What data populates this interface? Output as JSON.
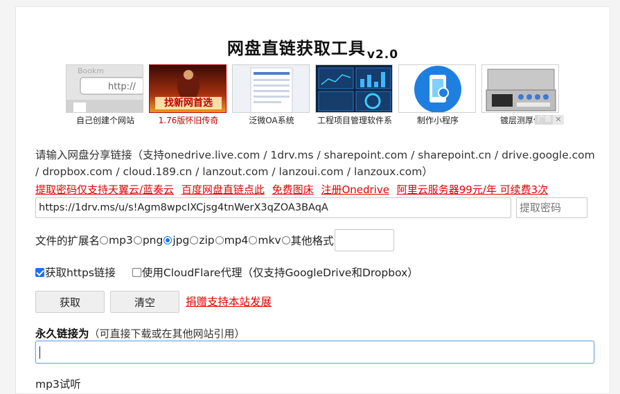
{
  "title": {
    "main": "网盘直链获取工具",
    "version": "v2.0"
  },
  "ads": [
    {
      "caption": "自己创建个网站",
      "icon": "browser-url-bar-image",
      "red": false
    },
    {
      "caption": "1.76版怀旧传奇",
      "icon": "game-warrior-image",
      "red": true,
      "overlay": "找新网首选"
    },
    {
      "caption": "泛微OA系统",
      "icon": "document-form-image",
      "red": false
    },
    {
      "caption": "工程项目管理软件系",
      "icon": "dashboard-screens-image",
      "red": false
    },
    {
      "caption": "制作小程序",
      "icon": "phone-app-image",
      "red": false
    },
    {
      "caption": "镀层测厚仪",
      "icon": "instrument-case-image",
      "red": false
    }
  ],
  "ad_badge": "广告",
  "description": "请输入网盘分享链接（支持onedrive.live.com / 1drv.ms / sharepoint.com / sharepoint.cn / drive.google.com / dropbox.com / cloud.189.cn / lanzout.com / lanzoui.com / lanzoux.com）",
  "links": [
    "提取密码仅支持天翼云/蓝奏云",
    "百度网盘直链点此",
    "免费图床",
    "注册Onedrive",
    "阿里云服务器99元/年 可续费3次"
  ],
  "url_input": {
    "value": "https://1drv.ms/u/s!Agm8wpcIXCjsg4tnWerX3qZOA3BAqA"
  },
  "password_input": {
    "placeholder": "提取密码"
  },
  "extension": {
    "label": "文件的扩展名",
    "options": [
      "mp3",
      "png",
      "jpg",
      "zip",
      "mp4",
      "mkv",
      "其他格式"
    ],
    "selected": "jpg"
  },
  "options": {
    "https_label": "获取https链接",
    "https_checked": true,
    "cloudflare_label": "使用CloudFlare代理（仅支持GoogleDrive和Dropbox）",
    "cloudflare_checked": false
  },
  "buttons": {
    "fetch": "获取",
    "clear": "清空"
  },
  "donate_link": "捐赠支持本站发展",
  "permanent": {
    "label": "永久链接为",
    "sub": "（可直接下载或在其他网站引用）"
  },
  "mp3_label": "mp3试听",
  "colors": {
    "link_red": "#e00000",
    "accent_blue": "#1a73e8"
  }
}
